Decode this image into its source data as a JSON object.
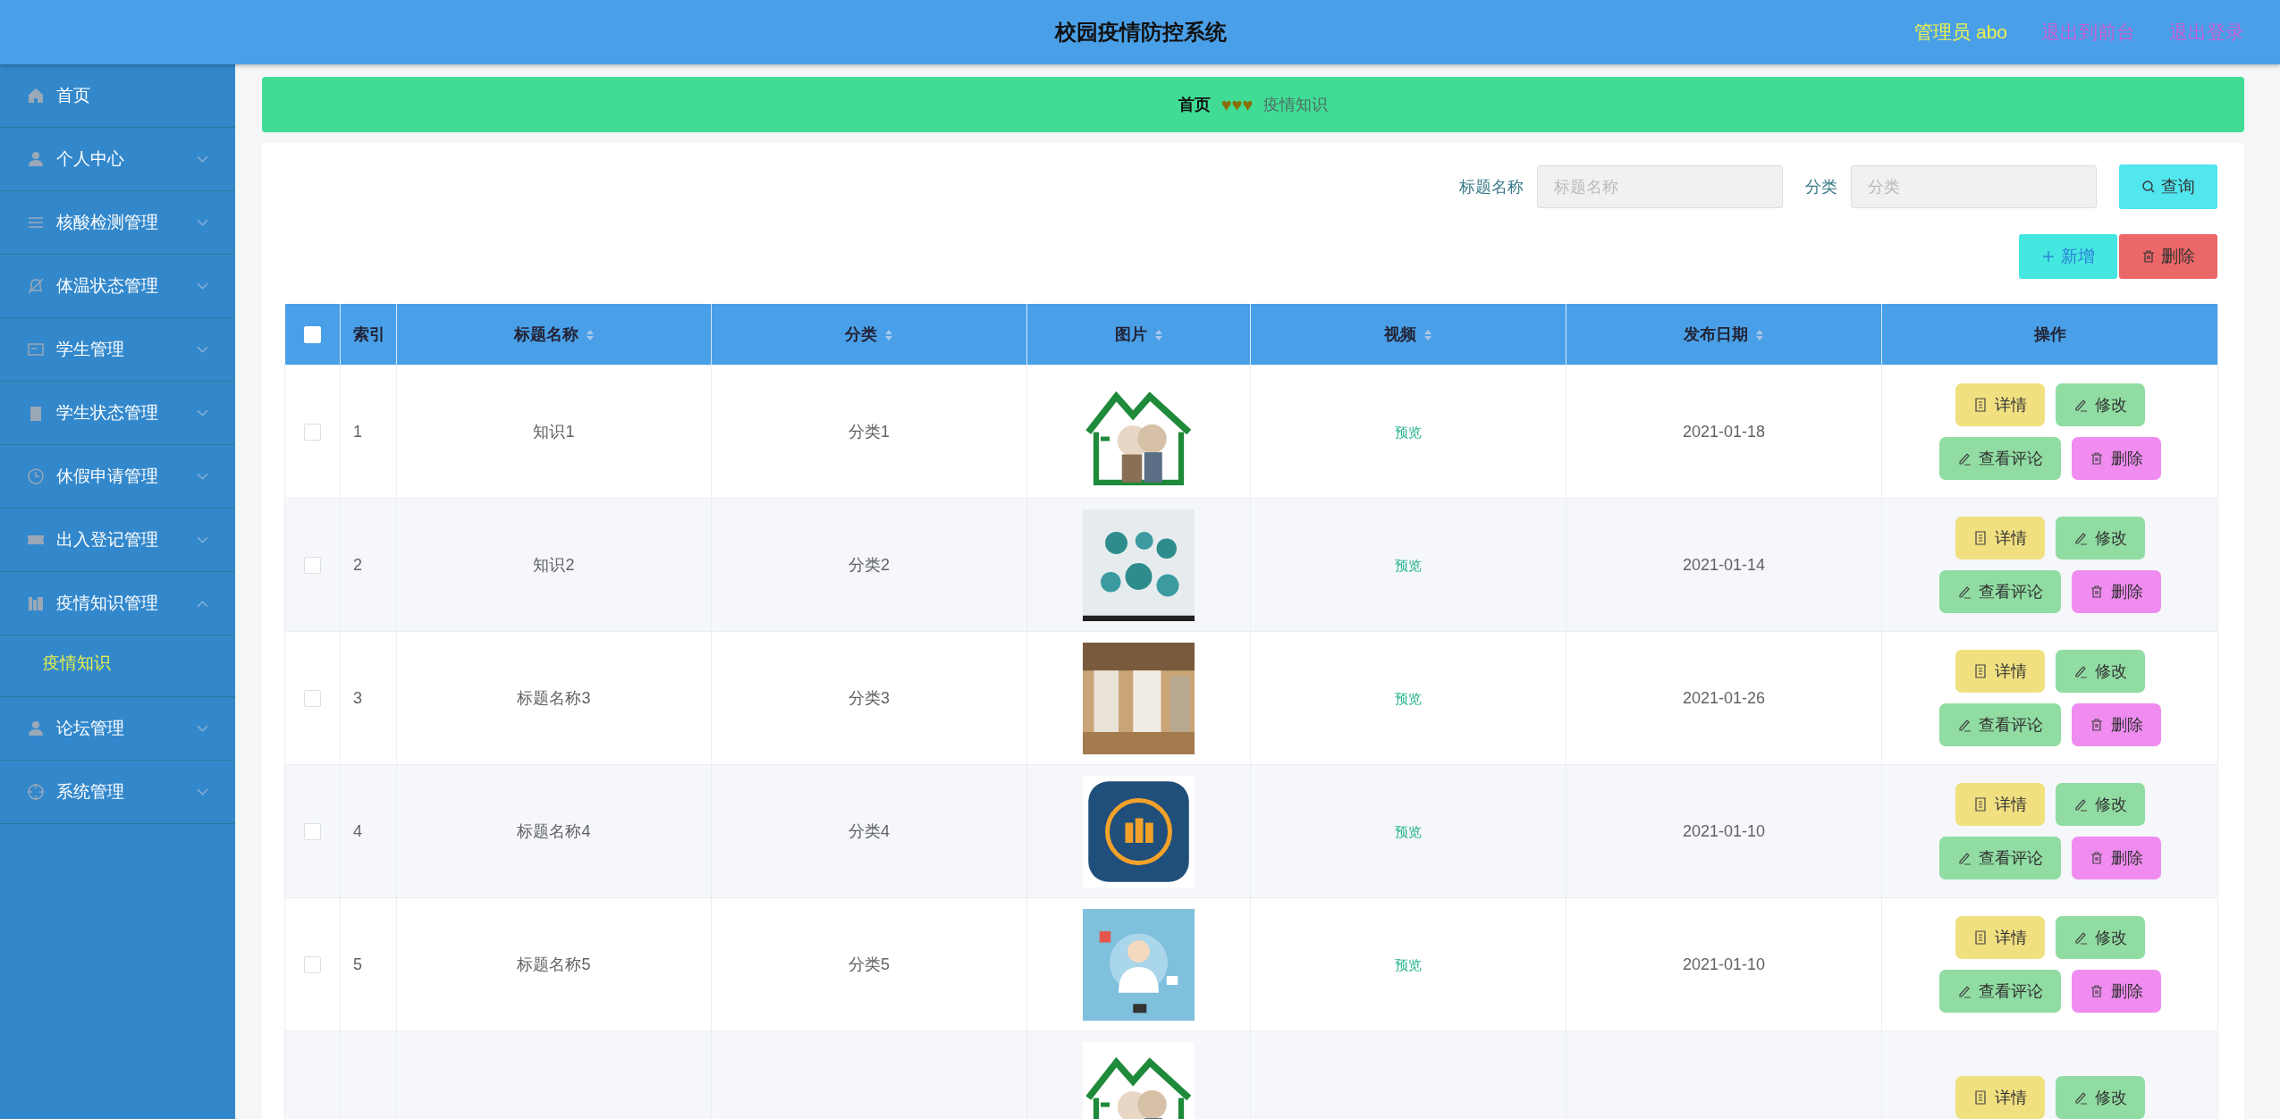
{
  "header": {
    "title": "校园疫情防控系统",
    "user": "管理员 abo",
    "links": [
      "退出到前台",
      "退出登录"
    ]
  },
  "sidebar": {
    "items": [
      {
        "label": "首页",
        "kind": "link"
      },
      {
        "label": "个人中心",
        "kind": "menu",
        "expanded": false
      },
      {
        "label": "核酸检测管理",
        "kind": "menu",
        "expanded": false
      },
      {
        "label": "体温状态管理",
        "kind": "menu",
        "expanded": false
      },
      {
        "label": "学生管理",
        "kind": "menu",
        "expanded": false
      },
      {
        "label": "学生状态管理",
        "kind": "menu",
        "expanded": false
      },
      {
        "label": "休假申请管理",
        "kind": "menu",
        "expanded": false
      },
      {
        "label": "出入登记管理",
        "kind": "menu",
        "expanded": false
      },
      {
        "label": "疫情知识管理",
        "kind": "menu",
        "expanded": true,
        "children": [
          {
            "label": "疫情知识",
            "selected": true
          }
        ]
      },
      {
        "label": "论坛管理",
        "kind": "menu",
        "expanded": false
      },
      {
        "label": "系统管理",
        "kind": "menu",
        "expanded": false
      }
    ]
  },
  "breadcrumb": {
    "items": [
      "首页",
      "疫情知识"
    ],
    "separator": "♥♥♥"
  },
  "search": {
    "fields": [
      {
        "label": "标题名称",
        "placeholder": "标题名称"
      },
      {
        "label": "分类",
        "placeholder": "分类"
      }
    ],
    "button": "查询"
  },
  "actions": [
    {
      "label": "新增",
      "kind": "add"
    },
    {
      "label": "删除",
      "kind": "delete"
    }
  ],
  "table": {
    "select_all": {
      "checked": false
    },
    "columns": [
      {
        "label": "索引",
        "sortable": false
      },
      {
        "label": "标题名称",
        "sortable": true
      },
      {
        "label": "分类",
        "sortable": true
      },
      {
        "label": "图片",
        "sortable": true
      },
      {
        "label": "视频",
        "sortable": true
      },
      {
        "label": "发布日期",
        "sortable": true
      },
      {
        "label": "操作",
        "sortable": false
      }
    ],
    "rows": [
      {
        "checked": false,
        "index": "1",
        "title": "知识1",
        "category": "分类1",
        "video": "预览",
        "date": "2021-01-18",
        "buttons": [
          {
            "label": "详情",
            "kind": "detail"
          },
          {
            "label": "修改",
            "kind": "edit"
          },
          {
            "label": "查看评论",
            "kind": "comment"
          },
          {
            "label": "删除",
            "kind": "delete"
          }
        ]
      },
      {
        "checked": false,
        "index": "2",
        "title": "知识2",
        "category": "分类2",
        "video": "预览",
        "date": "2021-01-14",
        "buttons": [
          {
            "label": "详情",
            "kind": "detail"
          },
          {
            "label": "修改",
            "kind": "edit"
          },
          {
            "label": "查看评论",
            "kind": "comment"
          },
          {
            "label": "删除",
            "kind": "delete"
          }
        ]
      },
      {
        "checked": false,
        "index": "3",
        "title": "标题名称3",
        "category": "分类3",
        "video": "预览",
        "date": "2021-01-26",
        "buttons": [
          {
            "label": "详情",
            "kind": "detail"
          },
          {
            "label": "修改",
            "kind": "edit"
          },
          {
            "label": "查看评论",
            "kind": "comment"
          },
          {
            "label": "删除",
            "kind": "delete"
          }
        ]
      },
      {
        "checked": false,
        "index": "4",
        "title": "标题名称4",
        "category": "分类4",
        "video": "预览",
        "date": "2021-01-10",
        "buttons": [
          {
            "label": "详情",
            "kind": "detail"
          },
          {
            "label": "修改",
            "kind": "edit"
          },
          {
            "label": "查看评论",
            "kind": "comment"
          },
          {
            "label": "删除",
            "kind": "delete"
          }
        ]
      },
      {
        "checked": false,
        "index": "5",
        "title": "标题名称5",
        "category": "分类5",
        "video": "预览",
        "date": "2021-01-10",
        "buttons": [
          {
            "label": "详情",
            "kind": "detail"
          },
          {
            "label": "修改",
            "kind": "edit"
          },
          {
            "label": "查看评论",
            "kind": "comment"
          },
          {
            "label": "删除",
            "kind": "delete"
          }
        ]
      },
      {
        "buttons": [
          {
            "label": "详情",
            "kind": "detail"
          },
          {
            "label": "修改",
            "kind": "edit"
          }
        ]
      }
    ]
  }
}
